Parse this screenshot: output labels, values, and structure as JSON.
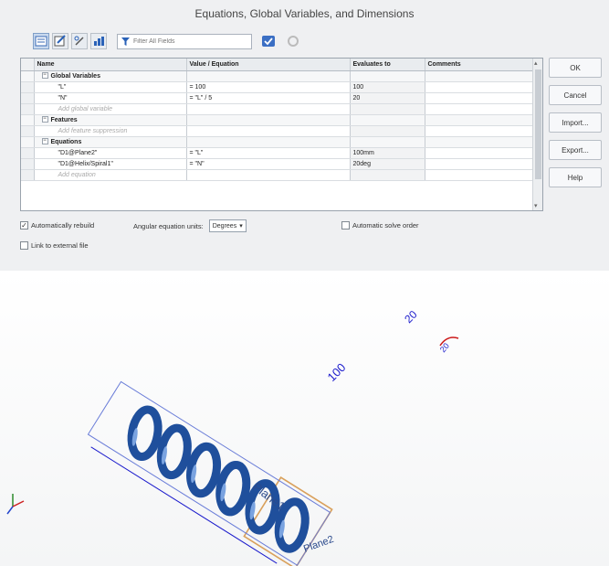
{
  "dialog": {
    "title": "Equations, Global Variables, and Dimensions",
    "filter_placeholder": "Filter All Fields",
    "columns": [
      "Name",
      "Value / Equation",
      "Evaluates to",
      "Comments"
    ],
    "rows": [
      {
        "type": "section",
        "name": "Global Variables",
        "value": "",
        "eval": "",
        "comment": ""
      },
      {
        "type": "item",
        "name": "\"L\"",
        "value": "= 100",
        "eval": "100",
        "comment": ""
      },
      {
        "type": "item",
        "name": "\"N\"",
        "value": "= \"L\" / 5",
        "eval": "20",
        "comment": ""
      },
      {
        "type": "add",
        "name": "Add global variable",
        "value": "",
        "eval": "",
        "comment": ""
      },
      {
        "type": "section",
        "name": "Features",
        "value": "",
        "eval": "",
        "comment": ""
      },
      {
        "type": "add",
        "name": "Add feature suppression",
        "value": "",
        "eval": "",
        "comment": ""
      },
      {
        "type": "section",
        "name": "Equations",
        "value": "",
        "eval": "",
        "comment": ""
      },
      {
        "type": "item",
        "name": "\"D1@Plane2\"",
        "value": "= \"L\"",
        "eval": "100mm",
        "comment": ""
      },
      {
        "type": "item",
        "name": "\"D1@Helix/Spiral1\"",
        "value": "= \"N\"",
        "eval": "20deg",
        "comment": ""
      },
      {
        "type": "add",
        "name": "Add equation",
        "value": "",
        "eval": "",
        "comment": ""
      }
    ],
    "buttons": {
      "ok": "OK",
      "cancel": "Cancel",
      "import": "Import...",
      "export": "Export...",
      "help": "Help"
    },
    "options": {
      "auto_rebuild": "Automatically rebuild",
      "auto_rebuild_checked": true,
      "angular_units_label": "Angular equation units:",
      "angular_units_value": "Degrees",
      "auto_solve": "Automatic solve order",
      "auto_solve_checked": false,
      "link_external": "Link to external file",
      "link_external_checked": false
    }
  },
  "viewport": {
    "dimension_length": "100",
    "dimension_turns": "20",
    "dimension_angle": "20",
    "plane1_label": "Plane1",
    "plane2_label": "Plane2",
    "spring_color": "#1f4f9c",
    "dimension_color": "#1a1acc",
    "plane_color": "#d9a05b"
  }
}
